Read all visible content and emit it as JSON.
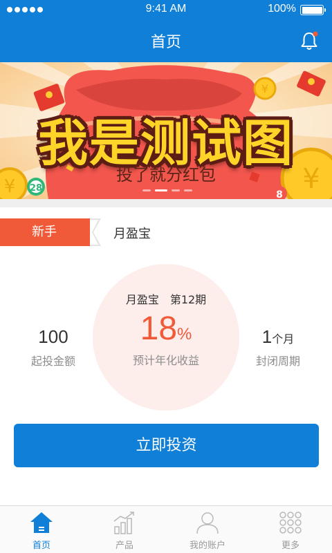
{
  "status_bar": {
    "time": "9:41 AM",
    "battery": "100%",
    "battery_level": 1.0
  },
  "nav": {
    "title": "首页",
    "icon": "bell-icon"
  },
  "banner": {
    "title": "我是测试图",
    "subtitle": "投了就分红包",
    "coin_text_left": "28",
    "coin_text_right": "8",
    "active_slide": 2,
    "slide_count": 4
  },
  "product": {
    "tag": "新手",
    "name": "月盈宝",
    "period": "月盈宝　第12期",
    "rate_value": "18",
    "rate_unit": "%",
    "rate_label": "预计年化收益",
    "min_amount_value": "100",
    "min_amount_label": "起投金额",
    "term_value": "1",
    "term_unit": "个月",
    "term_label": "封闭周期"
  },
  "invest_button": {
    "label": "立即投资"
  },
  "tab_bar": {
    "tabs": [
      {
        "label": "首页",
        "icon": "home-icon",
        "active": true
      },
      {
        "label": "产品",
        "icon": "chart-icon",
        "active": false
      },
      {
        "label": "我的账户",
        "icon": "user-icon",
        "active": false
      },
      {
        "label": "更多",
        "icon": "grid-icon",
        "active": false
      }
    ]
  },
  "colors": {
    "primary": "#0f7fd8",
    "accent": "#f05a38",
    "circle_bg": "#fdeeec"
  }
}
